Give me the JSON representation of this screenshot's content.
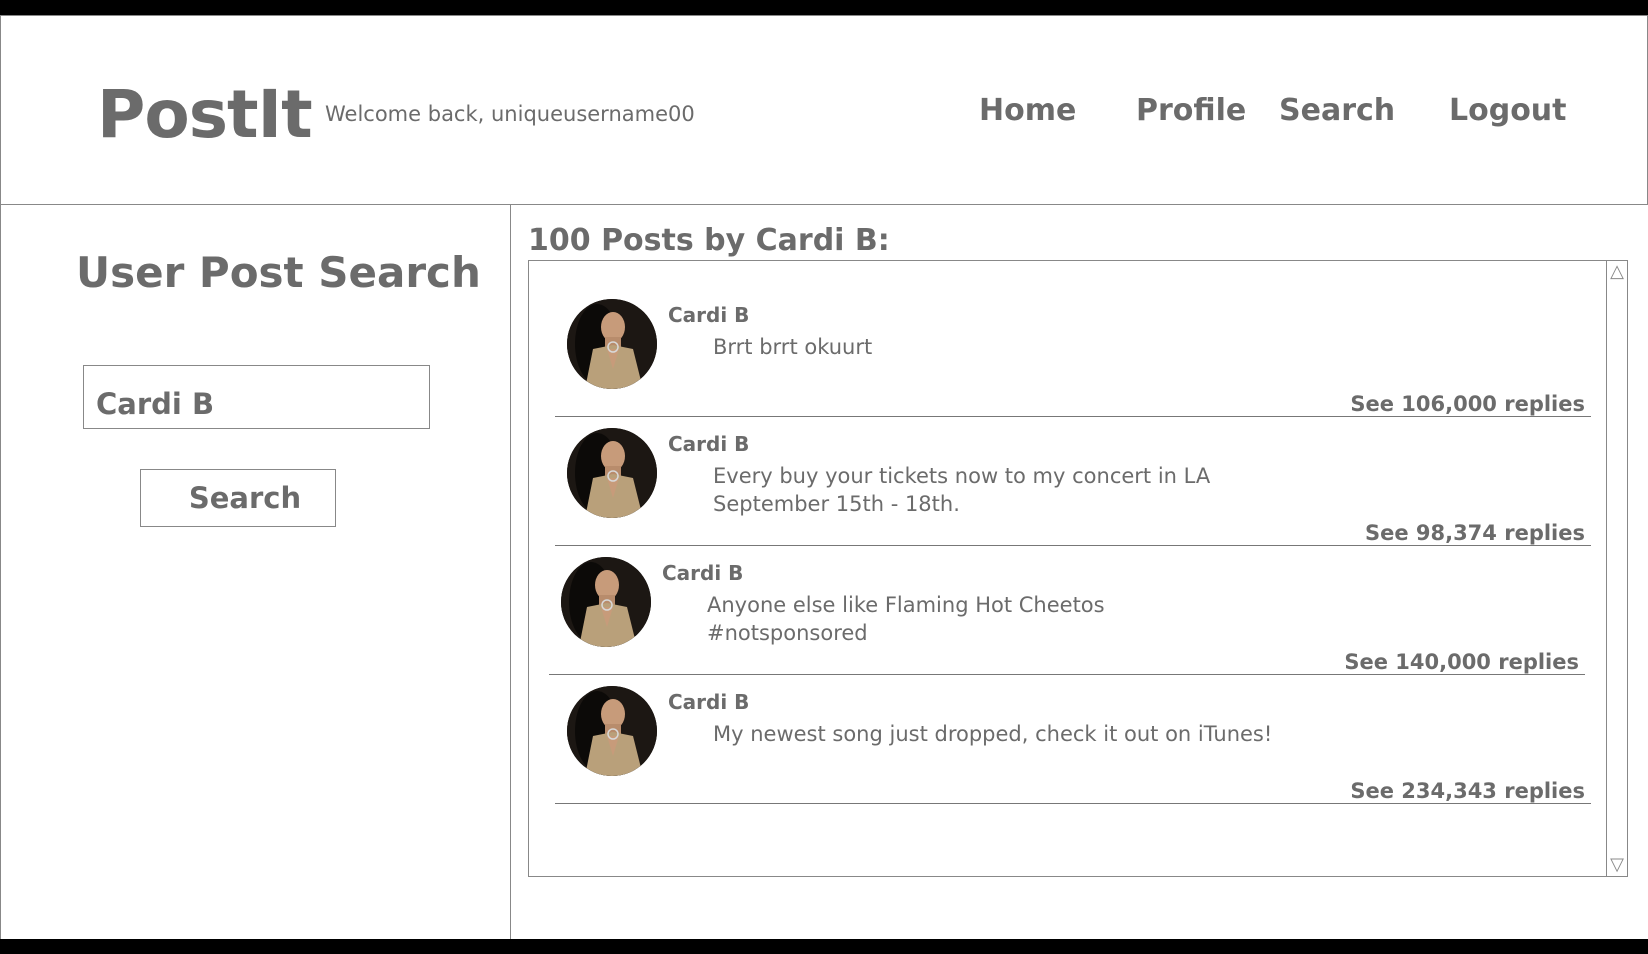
{
  "header": {
    "logo": "PostIt",
    "welcome": "Welcome back, uniqueusername00",
    "nav": {
      "home": "Home",
      "profile": "Profile",
      "search": "Search",
      "logout": "Logout"
    }
  },
  "search_panel": {
    "title": "User Post Search",
    "input_value": "Cardi B",
    "button_label": "Search"
  },
  "results": {
    "title": "100 Posts by Cardi B:",
    "posts": [
      {
        "author": "Cardi B",
        "text": "Brrt brrt okuurt",
        "replies": "See 106,000 replies"
      },
      {
        "author": "Cardi B",
        "text": "Every buy your tickets now to my concert in LA September 15th - 18th.",
        "replies": "See 98,374 replies"
      },
      {
        "author": "Cardi B",
        "text": "Anyone else like Flaming Hot Cheetos #notsponsored",
        "replies": "See 140,000 replies"
      },
      {
        "author": "Cardi B",
        "text": "My newest song just dropped, check it out on iTunes!",
        "replies": "See 234,343 replies"
      }
    ],
    "scroll_up_icon": "triangle-up-icon",
    "scroll_down_icon": "triangle-down-icon"
  }
}
